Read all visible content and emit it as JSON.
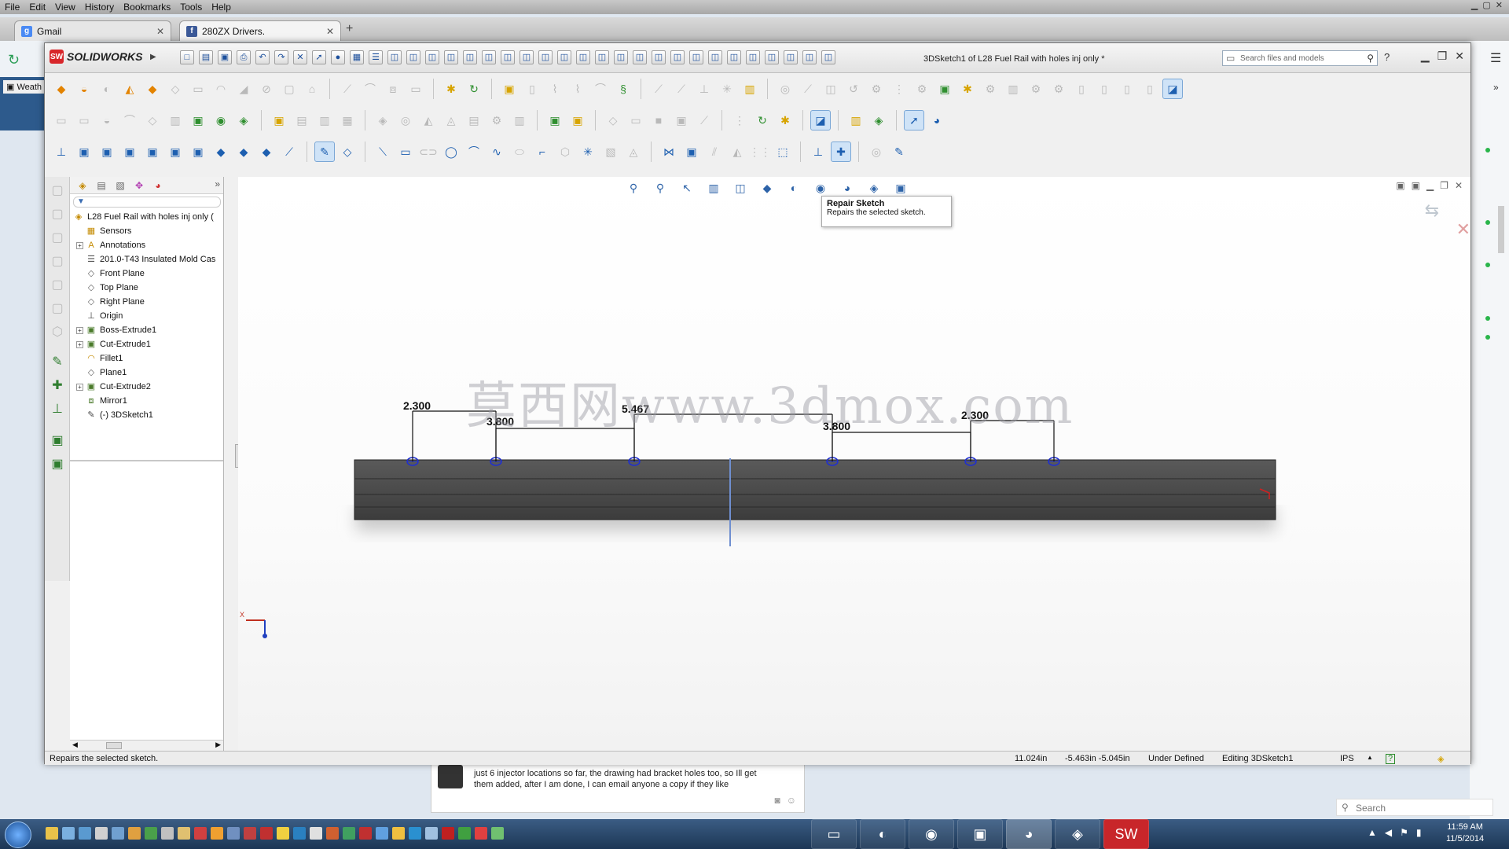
{
  "browser": {
    "menu": [
      "File",
      "Edit",
      "View",
      "History",
      "Bookmarks",
      "Tools",
      "Help"
    ],
    "tabs": [
      {
        "label": "Gmail",
        "icon": "gmail-icon"
      },
      {
        "label": "280ZX Drivers.",
        "icon": "facebook-icon"
      }
    ],
    "bookmark_weather": "Weath"
  },
  "solidworks": {
    "app_name": "SOLIDWORKS",
    "document_title": "3DSketch1 of L28 Fuel Rail with holes inj only *",
    "search_placeholder": "Search files and models",
    "help_label": "?",
    "tree": {
      "root": "L28 Fuel Rail with holes inj only (",
      "items": [
        {
          "label": "Sensors",
          "icon": "sensors-icon",
          "expandable": false
        },
        {
          "label": "Annotations",
          "icon": "annotations-icon",
          "expandable": true
        },
        {
          "label": "201.0-T43 Insulated Mold Cas",
          "icon": "material-icon",
          "expandable": false
        },
        {
          "label": "Front Plane",
          "icon": "plane-icon",
          "expandable": false
        },
        {
          "label": "Top Plane",
          "icon": "plane-icon",
          "expandable": false
        },
        {
          "label": "Right Plane",
          "icon": "plane-icon",
          "expandable": false
        },
        {
          "label": "Origin",
          "icon": "origin-icon",
          "expandable": false
        },
        {
          "label": "Boss-Extrude1",
          "icon": "extrude-icon",
          "expandable": true
        },
        {
          "label": "Cut-Extrude1",
          "icon": "cut-icon",
          "expandable": true
        },
        {
          "label": "Fillet1",
          "icon": "fillet-icon",
          "expandable": false
        },
        {
          "label": "Plane1",
          "icon": "plane-icon",
          "expandable": false
        },
        {
          "label": "Cut-Extrude2",
          "icon": "cut-icon",
          "expandable": true
        },
        {
          "label": "Mirror1",
          "icon": "mirror-icon",
          "expandable": false
        },
        {
          "label": "(-) 3DSketch1",
          "icon": "sketch3d-icon",
          "expandable": false
        }
      ]
    },
    "tooltip": {
      "title": "Repair Sketch",
      "desc": "Repairs the selected sketch."
    },
    "watermark": "莫西网www.3dmox.com",
    "dimensions": [
      "2.300",
      "3.800",
      "5.467",
      "3.800",
      "2.300"
    ],
    "status": {
      "message": "Repairs the selected sketch.",
      "coord1": "11.024in",
      "coord2": "-5.463in -5.045in",
      "state": "Under Defined",
      "mode": "Editing 3DSketch1",
      "units": "IPS",
      "units_arrow": "▲",
      "help": "?"
    }
  },
  "feed": {
    "comment": "just 6 injector locations so far, the drawing had bracket holes too, so Ill get them added, after I am done, I can email anyone a copy if they like"
  },
  "chat": {
    "search_placeholder": "Search"
  },
  "taskbar": {
    "time": "11:59 AM",
    "date": "11/5/2014"
  },
  "colors": {
    "sw_red": "#d8262a",
    "rail": "#4a4a4a",
    "hole": "#1f2fd0",
    "accent": "#1d5fb0"
  }
}
